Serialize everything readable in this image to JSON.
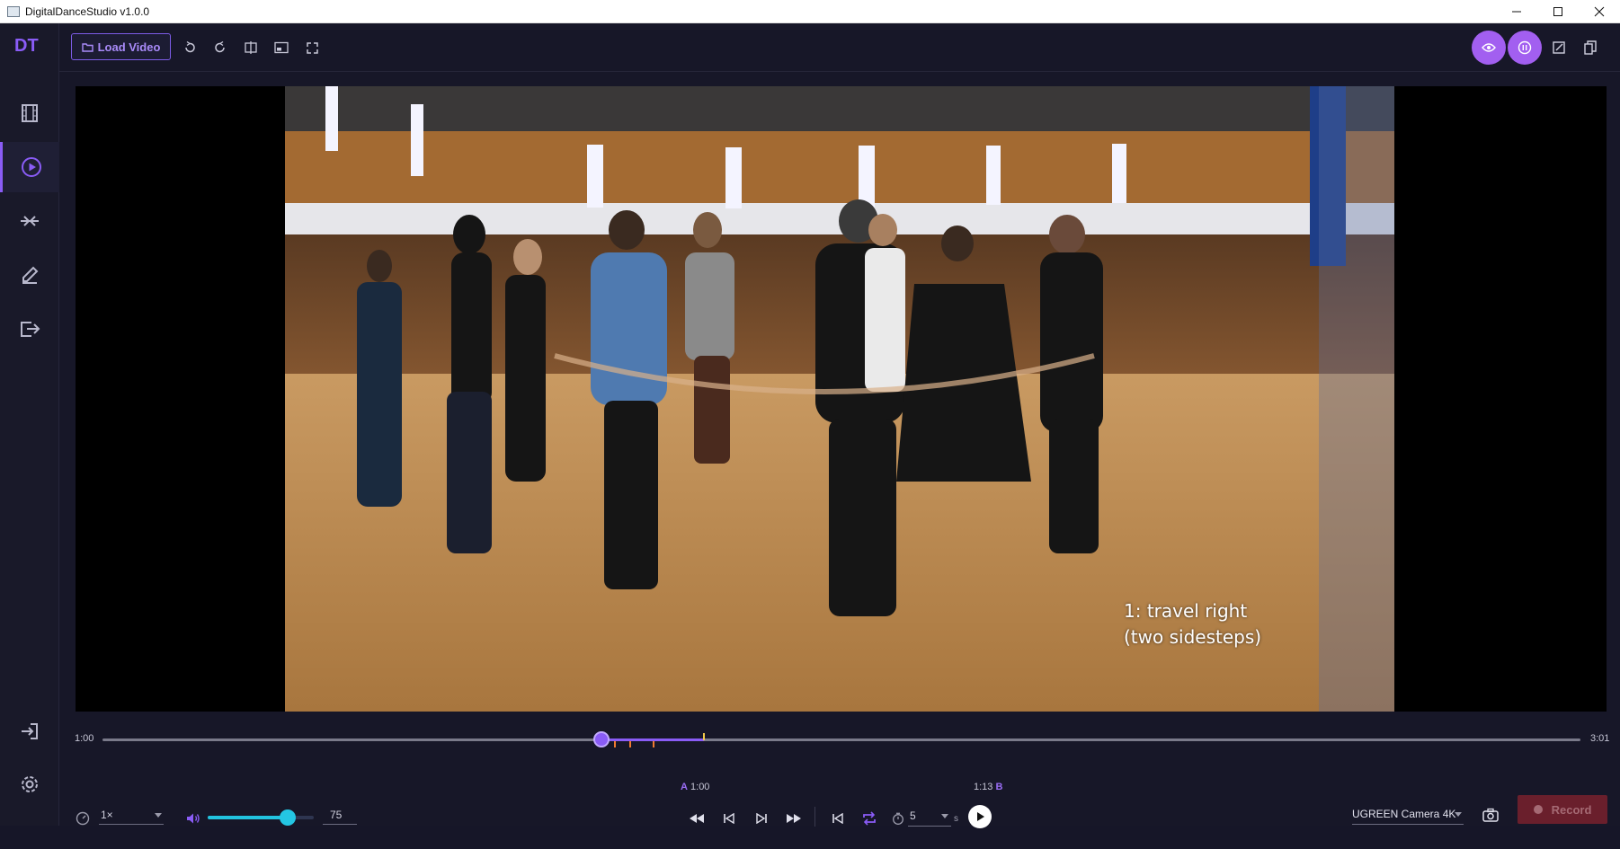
{
  "window": {
    "title": "DigitalDanceStudio v1.0.0"
  },
  "sidebar": {
    "logo": "DT",
    "items": [
      {
        "name": "library",
        "icon": "film-icon"
      },
      {
        "name": "player",
        "icon": "play-circle-icon",
        "active": true
      },
      {
        "name": "compare",
        "icon": "compare-arrows-icon"
      },
      {
        "name": "annotate",
        "icon": "pencil-icon"
      },
      {
        "name": "export",
        "icon": "export-icon"
      }
    ],
    "bottom": [
      {
        "name": "login",
        "icon": "login-icon"
      },
      {
        "name": "settings",
        "icon": "gear-icon"
      }
    ]
  },
  "toolbar": {
    "load_video_label": "Load Video",
    "icons": [
      "rotate-left-icon",
      "rotate-right-icon",
      "mirror-icon",
      "picture-in-picture-icon",
      "fullscreen-icon"
    ],
    "right_icons": [
      "eye-icon",
      "pause-overlay-icon",
      "edit-icon",
      "bookmark-icon"
    ]
  },
  "video": {
    "subtitle_line1": "1: travel right",
    "subtitle_line2": "(two sidesteps)"
  },
  "timeline": {
    "start": "1:00",
    "end": "3:01",
    "progress": 0.3374,
    "loop_end_fraction": 0.407,
    "a_time": "1:00",
    "b_time": "1:13",
    "a_label": "A",
    "b_label": "B"
  },
  "controls": {
    "speed": "1×",
    "volume": "75",
    "volume_level": 0.75,
    "loop_seconds": "5",
    "loop_unit": "s",
    "camera": "UGREEN Camera 4K",
    "record_label": "Record"
  },
  "colors": {
    "accent": "#8a5cf6",
    "volume": "#22c3df",
    "record": "#6a1f2c"
  }
}
